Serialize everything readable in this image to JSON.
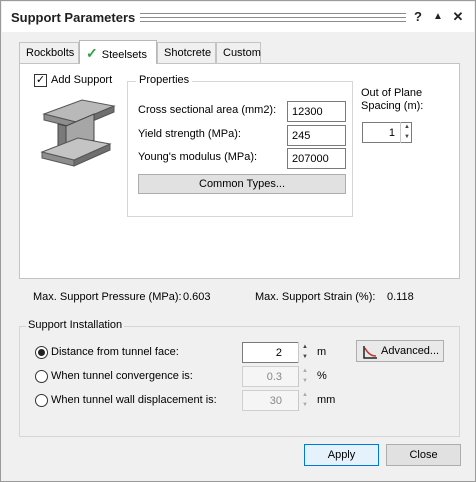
{
  "window": {
    "title": "Support Parameters",
    "help_glyph": "?",
    "collapse_glyph": "▲",
    "close_glyph": "✕"
  },
  "tabs": [
    {
      "label": "Rockbolts",
      "active": false
    },
    {
      "label": "Steelsets",
      "active": true
    },
    {
      "label": "Shotcrete",
      "active": false
    },
    {
      "label": "Custom",
      "active": false
    }
  ],
  "steelsets": {
    "add_support_label": "Add Support",
    "add_support_checked": "✓",
    "properties_title": "Properties",
    "cross_section_label": "Cross sectional area (mm2):",
    "cross_section_value": "12300",
    "yield_label": "Yield strength (MPa):",
    "yield_value": "245",
    "youngs_label": "Young's modulus (MPa):",
    "youngs_value": "207000",
    "common_types_label": "Common Types...",
    "out_of_plane_label_1": "Out of Plane",
    "out_of_plane_label_2": "Spacing (m):",
    "out_of_plane_value": "1"
  },
  "status": {
    "max_pressure_label": "Max. Support Pressure (MPa):",
    "max_pressure_value": "0.603",
    "max_strain_label": "Max. Support Strain (%):",
    "max_strain_value": "0.118"
  },
  "installation": {
    "title": "Support Installation",
    "distance_label": "Distance from tunnel face:",
    "distance_value": "2",
    "distance_unit": "m",
    "convergence_label": "When tunnel convergence is:",
    "convergence_value": "0.3",
    "convergence_unit": "%",
    "wall_label": "When tunnel wall displacement is:",
    "wall_value": "30",
    "wall_unit": "mm",
    "advanced_label": "Advanced..."
  },
  "footer": {
    "apply_label": "Apply",
    "close_label": "Close"
  },
  "colors": {
    "accent_check": "#2ea043",
    "default_button_border": "#0078d7"
  }
}
